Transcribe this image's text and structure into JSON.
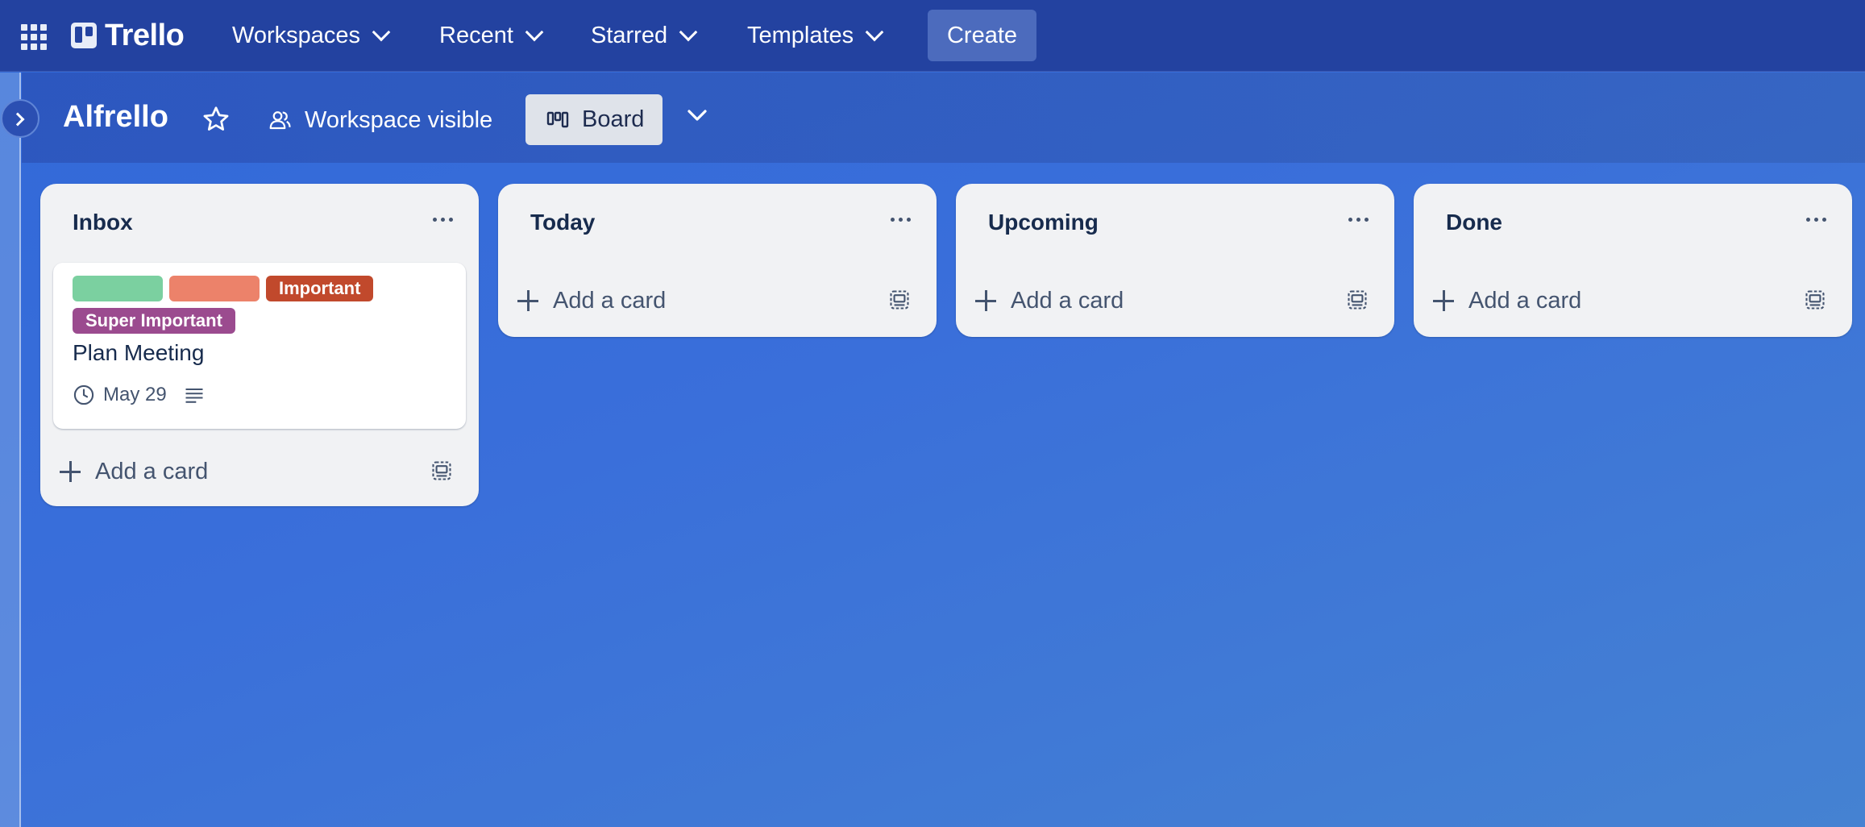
{
  "nav": {
    "logo": "Trello",
    "items": [
      {
        "label": "Workspaces"
      },
      {
        "label": "Recent"
      },
      {
        "label": "Starred"
      },
      {
        "label": "Templates"
      }
    ],
    "create_label": "Create"
  },
  "board": {
    "title": "Alfrello",
    "visibility_label": "Workspace visible",
    "view_label": "Board"
  },
  "lists": [
    {
      "title": "Inbox",
      "add_card_label": "Add a card",
      "cards": [
        {
          "labels": [
            {
              "text": "",
              "color": "#7bd0a0"
            },
            {
              "text": "",
              "color": "#ec826a"
            },
            {
              "text": "Important",
              "color": "#c1492c"
            },
            {
              "text": "Super Important",
              "color": "#9b4b8f"
            }
          ],
          "title": "Plan Meeting",
          "due": "May 29",
          "has_description": true
        }
      ]
    },
    {
      "title": "Today",
      "add_card_label": "Add a card",
      "cards": []
    },
    {
      "title": "Upcoming",
      "add_card_label": "Add a card",
      "cards": []
    },
    {
      "title": "Done",
      "add_card_label": "Add a card",
      "cards": []
    }
  ],
  "colors": {
    "nav_bg": "#2342a0",
    "board_bg": "#3a6fda",
    "list_bg": "#f1f2f4",
    "text": "#172b4d",
    "muted": "#44546f"
  },
  "icons": [
    "apps-grid-icon",
    "trello-logo-icon",
    "chevron-down-icon",
    "chevron-right-icon",
    "star-icon",
    "workspace-visible-icon",
    "board-icon",
    "more-dots-icon",
    "plus-icon",
    "card-template-icon",
    "clock-icon",
    "description-icon"
  ]
}
